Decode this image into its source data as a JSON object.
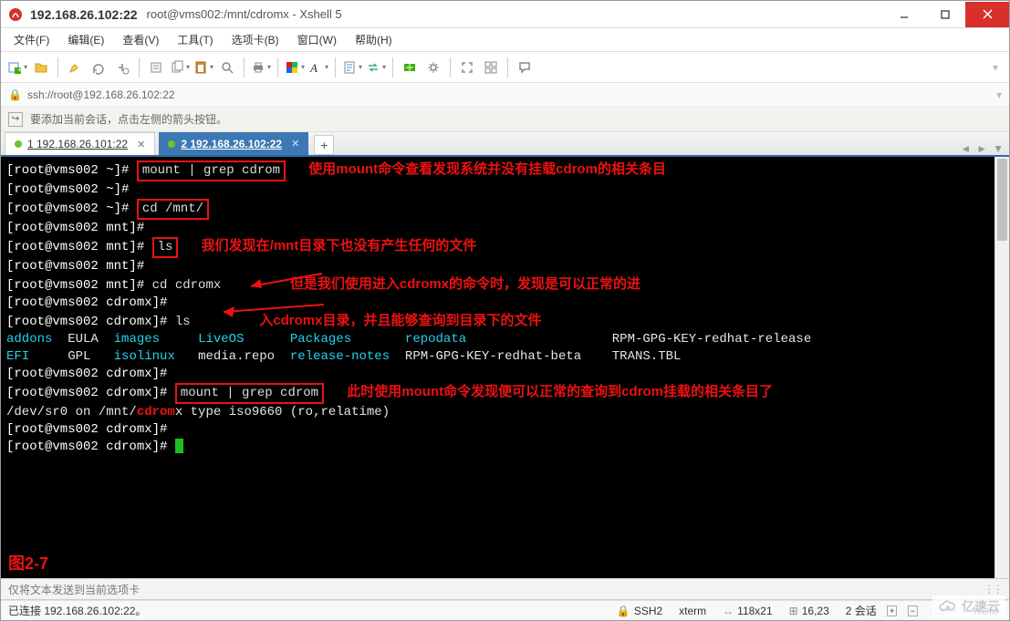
{
  "window": {
    "host_title": "192.168.26.102:22",
    "session_title": "root@vms002:/mnt/cdromx - Xshell 5"
  },
  "menu": {
    "file": "文件(F)",
    "edit": "编辑(E)",
    "view": "查看(V)",
    "tools": "工具(T)",
    "tabs": "选项卡(B)",
    "window": "窗口(W)",
    "help": "帮助(H)"
  },
  "address": {
    "url": "ssh://root@192.168.26.102:22"
  },
  "hint": {
    "text": "要添加当前会话，点击左侧的箭头按钮。"
  },
  "tabs": {
    "t1": {
      "label": "1 192.168.26.101:22"
    },
    "t2": {
      "label": "2 192.168.26.102:22"
    }
  },
  "terminal": {
    "lines": [
      {
        "prompt": "[root@vms002 ~]# ",
        "cmd": "mount | grep cdrom",
        "box": true
      },
      {
        "prompt": "[root@vms002 ~]# "
      },
      {
        "prompt": "[root@vms002 ~]# ",
        "cmd": "cd /mnt/",
        "box": true
      },
      {
        "prompt": "[root@vms002 mnt]# "
      },
      {
        "prompt": "[root@vms002 mnt]# ",
        "cmd": "ls",
        "box": true
      },
      {
        "prompt": "[root@vms002 mnt]# "
      },
      {
        "prompt": "[root@vms002 mnt]# ",
        "cmd": "cd cdromx"
      },
      {
        "prompt": "[root@vms002 cdromx]# "
      },
      {
        "prompt": "[root@vms002 cdromx]# ",
        "cmd": "ls"
      }
    ],
    "listing": {
      "row1": [
        "addons",
        "EULA",
        "images",
        "LiveOS",
        "Packages",
        "repodata",
        "",
        "RPM-GPG-KEY-redhat-release"
      ],
      "row2": [
        "EFI",
        "GPL",
        "isolinux",
        "media.repo",
        "release-notes",
        "RPM-GPG-KEY-redhat-beta",
        "",
        "TRANS.TBL"
      ],
      "colors1": [
        "c",
        "wh",
        "c",
        "c",
        "c",
        "c",
        "",
        "wh"
      ],
      "colors2": [
        "c",
        "wh",
        "c",
        "wh",
        "c",
        "wh",
        "",
        "wh"
      ]
    },
    "after": [
      {
        "prompt": "[root@vms002 cdromx]# "
      },
      {
        "prompt": "[root@vms002 cdromx]# ",
        "cmd": "mount | grep cdrom",
        "box": true
      }
    ],
    "mount_output_pre": "/dev/sr0 on /mnt/",
    "mount_output_hl": "cdrom",
    "mount_output_post": "x type iso9660 (ro,relatime)",
    "tail": [
      {
        "prompt": "[root@vms002 cdromx]# "
      },
      {
        "prompt": "[root@vms002 cdromx]# ",
        "cursor": true
      }
    ],
    "annot1": "使用mount命令查看发现系统并没有挂载cdrom的相关条目",
    "annot2": "我们发现在/mnt目录下也没有产生任何的文件",
    "annot3a": "但是我们使用进入cdromx的命令时，发现是可以正常的进",
    "annot3b": "入cdromx目录，并且能够查询到目录下的文件",
    "annot4": "此时使用mount命令发现便可以正常的查询到cdrom挂载的相关条目了",
    "fig": "图2-7"
  },
  "sendbar": {
    "text": "仅将文本发送到当前选项卡"
  },
  "status": {
    "conn": "已连接 192.168.26.102:22。",
    "proto": "SSH2",
    "term": "xterm",
    "size": "118x21",
    "pos": "16,23",
    "sessions": "2 会话",
    "caps": "CAP",
    "num": "NUM"
  },
  "watermark": {
    "text": "亿速云"
  }
}
